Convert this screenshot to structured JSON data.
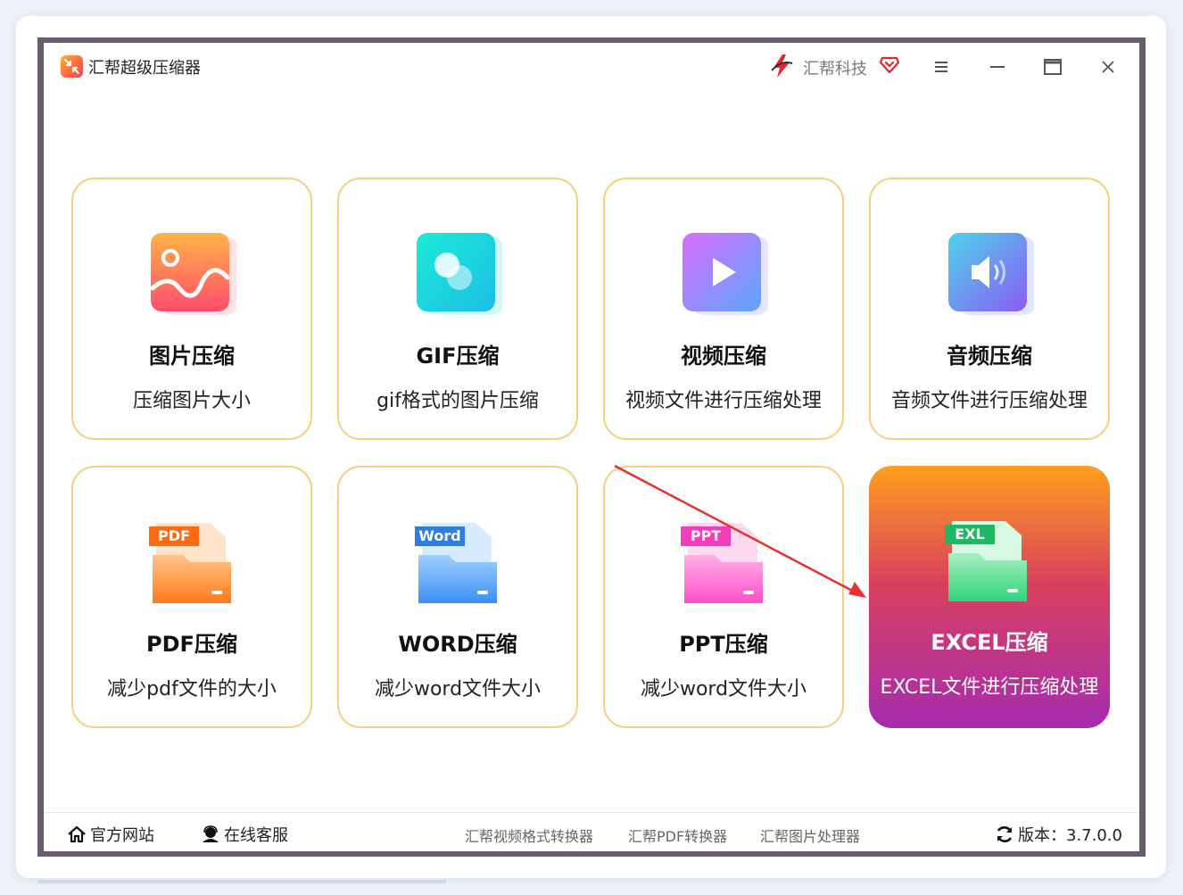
{
  "window": {
    "title": "汇帮超级压缩器",
    "brand": "汇帮科技"
  },
  "cards": [
    {
      "title": "图片压缩",
      "desc": "压缩图片大小",
      "icon": "image-icon",
      "colors": [
        "#ffb347",
        "#ff4d6d"
      ]
    },
    {
      "title": "GIF压缩",
      "desc": "gif格式的图片压缩",
      "icon": "gif-icon",
      "colors": [
        "#1de9d6",
        "#1cbfe6"
      ]
    },
    {
      "title": "视频压缩",
      "desc": "视频文件进行压缩处理",
      "icon": "video-play-icon",
      "colors": [
        "#d96cff",
        "#5aa8ff"
      ]
    },
    {
      "title": "音频压缩",
      "desc": "音频文件进行压缩处理",
      "icon": "audio-speaker-icon",
      "colors": [
        "#4fd1e8",
        "#8a5cf6"
      ]
    },
    {
      "title": "PDF压缩",
      "desc": "减少pdf文件的大小",
      "icon": "pdf-folder-icon",
      "badge": "PDF",
      "colors": [
        "#ffc48a",
        "#ff7a1a"
      ]
    },
    {
      "title": "WORD压缩",
      "desc": "减少word文件大小",
      "icon": "word-folder-icon",
      "badge": "Word",
      "colors": [
        "#9fd0ff",
        "#3d8ef5"
      ]
    },
    {
      "title": "PPT压缩",
      "desc": "减少word文件大小",
      "icon": "ppt-folder-icon",
      "badge": "PPT",
      "colors": [
        "#ffb0e6",
        "#ff4fc9"
      ]
    },
    {
      "title": "EXCEL压缩",
      "desc": "EXCEL文件进行压缩处理",
      "icon": "excel-folder-icon",
      "badge": "EXL",
      "colors": [
        "#a8f0c0",
        "#2fd47a"
      ],
      "active": true
    }
  ],
  "footer": {
    "official_site": "官方网站",
    "online_service": "在线客服",
    "products": [
      "汇帮视频格式转换器",
      "汇帮PDF转换器",
      "汇帮图片处理器"
    ],
    "version_label": "版本：3.7.0.0"
  },
  "colors": {
    "card_border": "#f5cf7a",
    "active_gradient_top": "#ff9f1c",
    "active_gradient_bottom": "#a52bb0",
    "annotation_arrow": "#e8322b"
  }
}
